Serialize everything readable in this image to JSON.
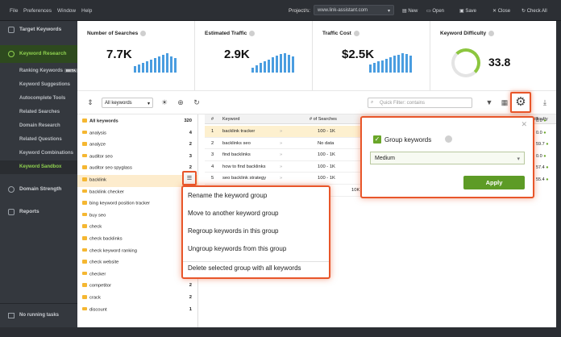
{
  "menu": {
    "file": "File",
    "preferences": "Preferences",
    "window": "Window",
    "help": "Help"
  },
  "project": {
    "label": "Project/s:",
    "value": "www.link-assistant.com"
  },
  "toolbar_top": {
    "new": "New",
    "open": "Open",
    "save": "Save",
    "close": "Close",
    "check_all": "Check All"
  },
  "sidebar": {
    "target_keywords": "Target Keywords",
    "keyword_research": "Keyword Research",
    "sub": [
      "Ranking Keywords",
      "Keyword Suggestions",
      "Autocomplete Tools",
      "Related Searches",
      "Domain Research",
      "Related Questions",
      "Keyword Combinations",
      "Keyword Sandbox"
    ],
    "beta": "BETA",
    "domain_strength": "Domain Strength",
    "reports": "Reports",
    "footer": "No running tasks"
  },
  "stats": [
    {
      "label": "Number of Searches",
      "value": "7.7K"
    },
    {
      "label": "Estimated Traffic",
      "value": "2.9K"
    },
    {
      "label": "Traffic Cost",
      "value": "$2.5K"
    },
    {
      "label": "Keyword Difficulty",
      "value": "33.8"
    }
  ],
  "filter_bar": {
    "dropdown": "All keywords",
    "filter_placeholder": "Quick Filter: contains"
  },
  "groups": [
    {
      "name": "All keywords",
      "count": "320"
    },
    {
      "name": "analysis",
      "count": "4"
    },
    {
      "name": "analyze",
      "count": "2"
    },
    {
      "name": "auditor seo",
      "count": "3"
    },
    {
      "name": "auditor seo spyglass",
      "count": "2"
    },
    {
      "name": "backlink",
      "count": "4"
    },
    {
      "name": "backlink checker",
      "count": ""
    },
    {
      "name": "bing keyword position tracker",
      "count": ""
    },
    {
      "name": "buy seo",
      "count": ""
    },
    {
      "name": "check",
      "count": ""
    },
    {
      "name": "check backlinks",
      "count": ""
    },
    {
      "name": "check keyword ranking",
      "count": ""
    },
    {
      "name": "check website",
      "count": ""
    },
    {
      "name": "checker",
      "count": "2"
    },
    {
      "name": "competitor",
      "count": "2"
    },
    {
      "name": "crack",
      "count": "2"
    },
    {
      "name": "discount",
      "count": "1"
    }
  ],
  "context_menu": [
    "Rename the keyword group",
    "Move to another keyword group",
    "Regroup keywords in this group",
    "Ungroup keywords from this group",
    "Delete selected group with all keywords"
  ],
  "grid": {
    "headers": {
      "num": "#",
      "keyword": "Keyword",
      "searches": "# of Searches",
      "difficulty": "Difficulty"
    },
    "rows": [
      {
        "n": "1",
        "kw": "backlink tracker",
        "s": "100 - 1K"
      },
      {
        "n": "2",
        "kw": "backlinks seo",
        "s": "No data"
      },
      {
        "n": "3",
        "kw": "find backlinks",
        "s": "100 - 1K"
      },
      {
        "n": "4",
        "kw": "how to find backlinks",
        "s": "100 - 1K"
      },
      {
        "n": "5",
        "kw": "seo backlink strategy",
        "s": "100 - 1K"
      }
    ],
    "right_vals": [
      "0.0",
      "0.0",
      "59.7",
      "0.0",
      "57.4",
      "55.4"
    ],
    "partial": "10K"
  },
  "settings_panel": {
    "checkbox_label": "Group keywords",
    "select_value": "Medium",
    "apply": "Apply"
  }
}
